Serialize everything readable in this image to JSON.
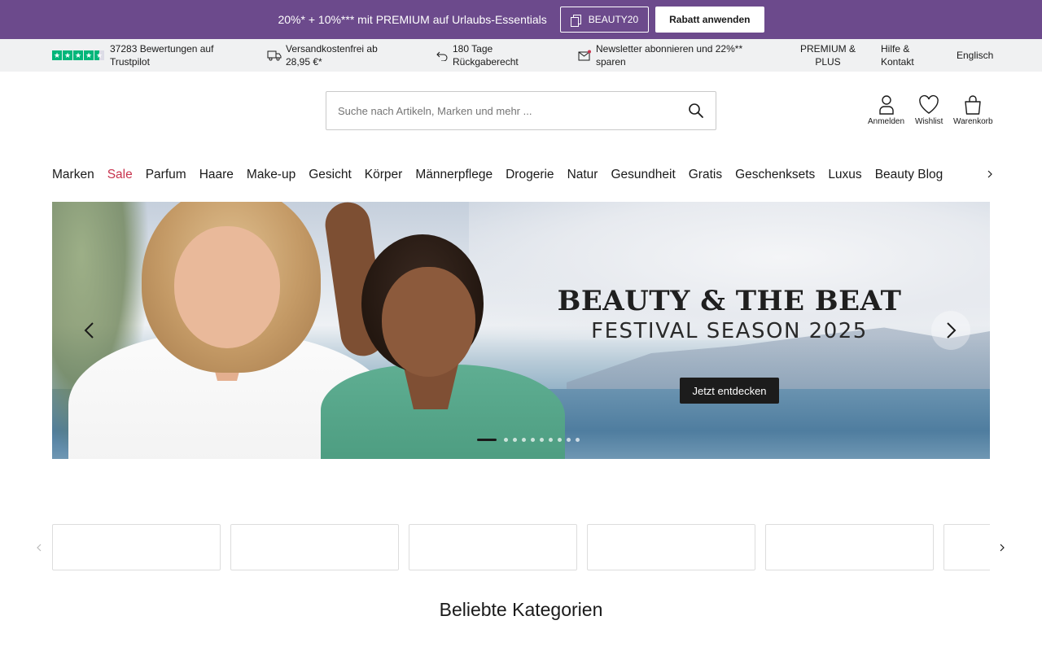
{
  "promo": {
    "text": "20%* + 10%*** mit PREMIUM auf Urlaubs-Essentials",
    "code": "BEAUTY20",
    "apply_label": "Rabatt anwenden",
    "background": "#6c4a8c"
  },
  "info_bar": {
    "trustpilot": {
      "text": "37283 Bewertungen auf Trustpilot",
      "icon": "trustpilot-stars-icon",
      "color": "#00b67a"
    },
    "shipping": {
      "text": "Versandkostenfrei ab 28,95 €*",
      "icon": "truck-icon"
    },
    "returns": {
      "text": "180 Tage Rückgaberecht",
      "icon": "return-arrow-icon"
    },
    "newsletter": {
      "text": "Newsletter abonnieren und 22%** sparen",
      "icon": "mail-icon"
    },
    "premium_link": "PREMIUM & PLUS",
    "help_link": "Hilfe & Kontakt",
    "language_link": "Englisch"
  },
  "header": {
    "search_placeholder": "Suche nach Artikeln, Marken und mehr ...",
    "account_label": "Anmelden",
    "wishlist_label": "Wishlist",
    "cart_label": "Warenkorb"
  },
  "nav": {
    "items": [
      "Marken",
      "Sale",
      "Parfum",
      "Haare",
      "Make-up",
      "Gesicht",
      "Körper",
      "Männerpflege",
      "Drogerie",
      "Natur",
      "Gesundheit",
      "Gratis",
      "Geschenksets",
      "Luxus",
      "Beauty Blog"
    ],
    "sale_color": "#c8344e"
  },
  "hero": {
    "title": "BEAUTY & THE BEAT",
    "subtitle": "FESTIVAL SEASON 2025",
    "cta_label": "Jetzt entdecken",
    "slide_count": 10,
    "active_slide": 1
  },
  "section": {
    "popular_categories_title": "Beliebte Kategorien"
  }
}
